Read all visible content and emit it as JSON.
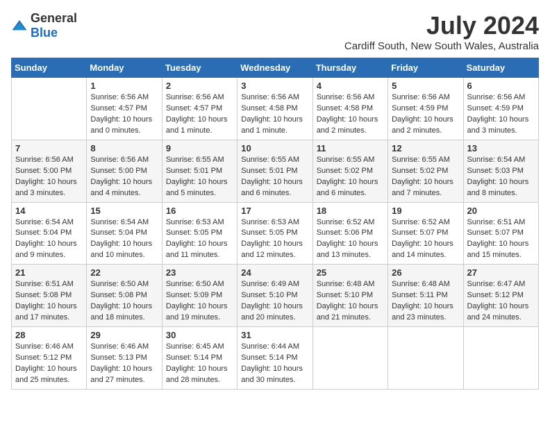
{
  "logo": {
    "general": "General",
    "blue": "Blue"
  },
  "title": "July 2024",
  "location": "Cardiff South, New South Wales, Australia",
  "weekdays": [
    "Sunday",
    "Monday",
    "Tuesday",
    "Wednesday",
    "Thursday",
    "Friday",
    "Saturday"
  ],
  "weeks": [
    [
      {
        "day": "",
        "sunrise": "",
        "sunset": "",
        "daylight": ""
      },
      {
        "day": "1",
        "sunrise": "Sunrise: 6:56 AM",
        "sunset": "Sunset: 4:57 PM",
        "daylight": "Daylight: 10 hours and 0 minutes."
      },
      {
        "day": "2",
        "sunrise": "Sunrise: 6:56 AM",
        "sunset": "Sunset: 4:57 PM",
        "daylight": "Daylight: 10 hours and 1 minute."
      },
      {
        "day": "3",
        "sunrise": "Sunrise: 6:56 AM",
        "sunset": "Sunset: 4:58 PM",
        "daylight": "Daylight: 10 hours and 1 minute."
      },
      {
        "day": "4",
        "sunrise": "Sunrise: 6:56 AM",
        "sunset": "Sunset: 4:58 PM",
        "daylight": "Daylight: 10 hours and 2 minutes."
      },
      {
        "day": "5",
        "sunrise": "Sunrise: 6:56 AM",
        "sunset": "Sunset: 4:59 PM",
        "daylight": "Daylight: 10 hours and 2 minutes."
      },
      {
        "day": "6",
        "sunrise": "Sunrise: 6:56 AM",
        "sunset": "Sunset: 4:59 PM",
        "daylight": "Daylight: 10 hours and 3 minutes."
      }
    ],
    [
      {
        "day": "7",
        "sunrise": "Sunrise: 6:56 AM",
        "sunset": "Sunset: 5:00 PM",
        "daylight": "Daylight: 10 hours and 3 minutes."
      },
      {
        "day": "8",
        "sunrise": "Sunrise: 6:56 AM",
        "sunset": "Sunset: 5:00 PM",
        "daylight": "Daylight: 10 hours and 4 minutes."
      },
      {
        "day": "9",
        "sunrise": "Sunrise: 6:55 AM",
        "sunset": "Sunset: 5:01 PM",
        "daylight": "Daylight: 10 hours and 5 minutes."
      },
      {
        "day": "10",
        "sunrise": "Sunrise: 6:55 AM",
        "sunset": "Sunset: 5:01 PM",
        "daylight": "Daylight: 10 hours and 6 minutes."
      },
      {
        "day": "11",
        "sunrise": "Sunrise: 6:55 AM",
        "sunset": "Sunset: 5:02 PM",
        "daylight": "Daylight: 10 hours and 6 minutes."
      },
      {
        "day": "12",
        "sunrise": "Sunrise: 6:55 AM",
        "sunset": "Sunset: 5:02 PM",
        "daylight": "Daylight: 10 hours and 7 minutes."
      },
      {
        "day": "13",
        "sunrise": "Sunrise: 6:54 AM",
        "sunset": "Sunset: 5:03 PM",
        "daylight": "Daylight: 10 hours and 8 minutes."
      }
    ],
    [
      {
        "day": "14",
        "sunrise": "Sunrise: 6:54 AM",
        "sunset": "Sunset: 5:04 PM",
        "daylight": "Daylight: 10 hours and 9 minutes."
      },
      {
        "day": "15",
        "sunrise": "Sunrise: 6:54 AM",
        "sunset": "Sunset: 5:04 PM",
        "daylight": "Daylight: 10 hours and 10 minutes."
      },
      {
        "day": "16",
        "sunrise": "Sunrise: 6:53 AM",
        "sunset": "Sunset: 5:05 PM",
        "daylight": "Daylight: 10 hours and 11 minutes."
      },
      {
        "day": "17",
        "sunrise": "Sunrise: 6:53 AM",
        "sunset": "Sunset: 5:05 PM",
        "daylight": "Daylight: 10 hours and 12 minutes."
      },
      {
        "day": "18",
        "sunrise": "Sunrise: 6:52 AM",
        "sunset": "Sunset: 5:06 PM",
        "daylight": "Daylight: 10 hours and 13 minutes."
      },
      {
        "day": "19",
        "sunrise": "Sunrise: 6:52 AM",
        "sunset": "Sunset: 5:07 PM",
        "daylight": "Daylight: 10 hours and 14 minutes."
      },
      {
        "day": "20",
        "sunrise": "Sunrise: 6:51 AM",
        "sunset": "Sunset: 5:07 PM",
        "daylight": "Daylight: 10 hours and 15 minutes."
      }
    ],
    [
      {
        "day": "21",
        "sunrise": "Sunrise: 6:51 AM",
        "sunset": "Sunset: 5:08 PM",
        "daylight": "Daylight: 10 hours and 17 minutes."
      },
      {
        "day": "22",
        "sunrise": "Sunrise: 6:50 AM",
        "sunset": "Sunset: 5:08 PM",
        "daylight": "Daylight: 10 hours and 18 minutes."
      },
      {
        "day": "23",
        "sunrise": "Sunrise: 6:50 AM",
        "sunset": "Sunset: 5:09 PM",
        "daylight": "Daylight: 10 hours and 19 minutes."
      },
      {
        "day": "24",
        "sunrise": "Sunrise: 6:49 AM",
        "sunset": "Sunset: 5:10 PM",
        "daylight": "Daylight: 10 hours and 20 minutes."
      },
      {
        "day": "25",
        "sunrise": "Sunrise: 6:48 AM",
        "sunset": "Sunset: 5:10 PM",
        "daylight": "Daylight: 10 hours and 21 minutes."
      },
      {
        "day": "26",
        "sunrise": "Sunrise: 6:48 AM",
        "sunset": "Sunset: 5:11 PM",
        "daylight": "Daylight: 10 hours and 23 minutes."
      },
      {
        "day": "27",
        "sunrise": "Sunrise: 6:47 AM",
        "sunset": "Sunset: 5:12 PM",
        "daylight": "Daylight: 10 hours and 24 minutes."
      }
    ],
    [
      {
        "day": "28",
        "sunrise": "Sunrise: 6:46 AM",
        "sunset": "Sunset: 5:12 PM",
        "daylight": "Daylight: 10 hours and 25 minutes."
      },
      {
        "day": "29",
        "sunrise": "Sunrise: 6:46 AM",
        "sunset": "Sunset: 5:13 PM",
        "daylight": "Daylight: 10 hours and 27 minutes."
      },
      {
        "day": "30",
        "sunrise": "Sunrise: 6:45 AM",
        "sunset": "Sunset: 5:14 PM",
        "daylight": "Daylight: 10 hours and 28 minutes."
      },
      {
        "day": "31",
        "sunrise": "Sunrise: 6:44 AM",
        "sunset": "Sunset: 5:14 PM",
        "daylight": "Daylight: 10 hours and 30 minutes."
      },
      {
        "day": "",
        "sunrise": "",
        "sunset": "",
        "daylight": ""
      },
      {
        "day": "",
        "sunrise": "",
        "sunset": "",
        "daylight": ""
      },
      {
        "day": "",
        "sunrise": "",
        "sunset": "",
        "daylight": ""
      }
    ]
  ]
}
